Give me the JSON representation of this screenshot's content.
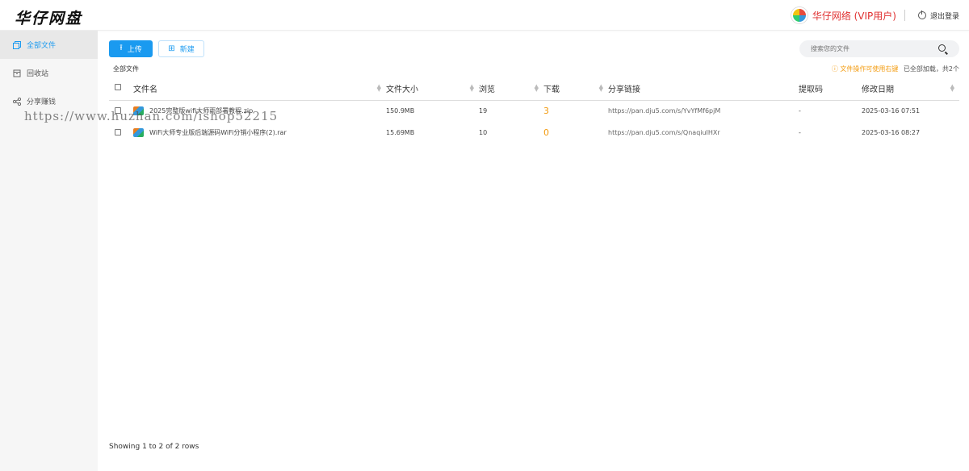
{
  "header": {
    "logo_text": "华仔网盘",
    "user_name": "华仔网络 (VIP用户)",
    "logout_label": "退出登录"
  },
  "sidebar": {
    "items": [
      {
        "label": "全部文件",
        "icon": "files-icon",
        "active": true
      },
      {
        "label": "回收站",
        "icon": "trash-icon",
        "active": false
      },
      {
        "label": "分享赚钱",
        "icon": "share-icon",
        "active": false
      }
    ]
  },
  "toolbar": {
    "upload_label": "上传",
    "new_label": "新建",
    "search_placeholder": "搜索您的文件"
  },
  "breadcrumb": "全部文件",
  "tip": {
    "hint": "文件操作可使用右键",
    "status": "已全部加载，共2个"
  },
  "table": {
    "columns": [
      "文件名",
      "文件大小",
      "浏览",
      "下载",
      "分享链接",
      "提取码",
      "修改日期"
    ],
    "rows": [
      {
        "name": "2025完整版wifi大师雨部署教程.zip",
        "size": "150.9MB",
        "views": "19",
        "downloads": "3",
        "link": "https://pan.dju5.com/s/YvYfMf6pjM",
        "code": "-",
        "date": "2025-03-16 07:51"
      },
      {
        "name": "WiFi大师专业版后端源码WiFi分销小程序(2).rar",
        "size": "15.69MB",
        "views": "10",
        "downloads": "0",
        "link": "https://pan.dju5.com/s/QnaqiuIHXr",
        "code": "-",
        "date": "2025-03-16 08:27"
      }
    ]
  },
  "footer": "Showing 1 to 2 of 2 rows",
  "watermark": "https://www.huzhan.com/ishop52215",
  "colors": {
    "accent": "#1a9af0",
    "warn": "#f39c12",
    "user": "#e03131"
  }
}
